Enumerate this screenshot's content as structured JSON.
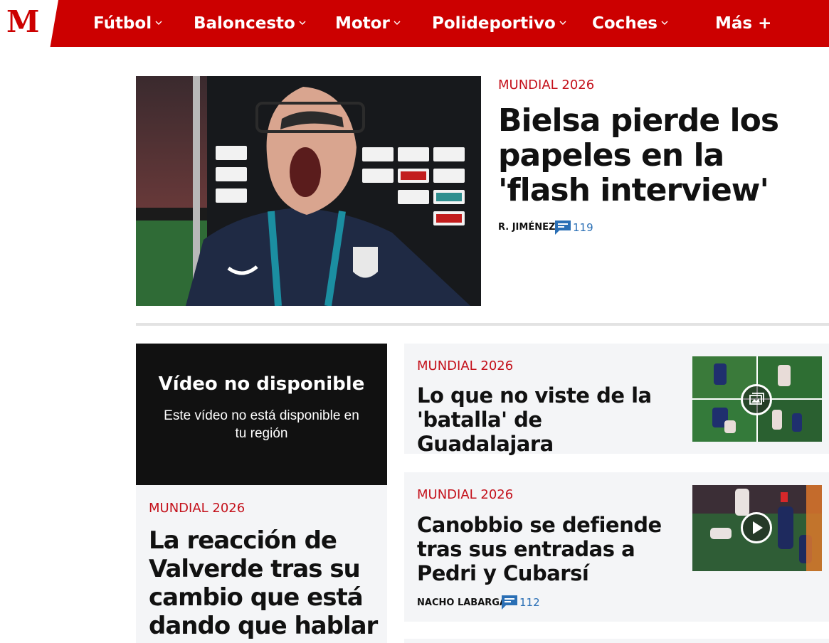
{
  "brand": {
    "logo_letter": "M"
  },
  "nav": [
    {
      "label": "Fútbol",
      "dropdown": true
    },
    {
      "label": "Baloncesto",
      "dropdown": true
    },
    {
      "label": "Motor",
      "dropdown": true
    },
    {
      "label": "Polideportivo",
      "dropdown": true
    },
    {
      "label": "Coches",
      "dropdown": true
    },
    {
      "label": "Más +",
      "dropdown": false
    }
  ],
  "hero": {
    "kicker": "MUNDIAL 2026",
    "title": "Bielsa pierde los papeles en la 'flash interview'",
    "author": "R. JIMÉNEZ",
    "comments": "119"
  },
  "video": {
    "title": "Vídeo no disponible",
    "message": "Este vídeo no está disponible en tu región",
    "kicker": "MUNDIAL 2026",
    "headline": "La reacción de Valverde tras su cambio que está dando que hablar"
  },
  "articles": [
    {
      "kicker": "MUNDIAL 2026",
      "title": "Lo que no viste de la 'batalla' de Guadalajara",
      "media": "gallery-icon"
    },
    {
      "kicker": "MUNDIAL 2026",
      "title": "Canobbio se defiende tras sus entradas a Pedri y Cubarsí",
      "author": "NACHO LABARGA",
      "comments": "112",
      "media": "play-icon"
    }
  ],
  "colors": {
    "brand_red": "#cc0000",
    "kicker_red": "#c4111b",
    "comment_blue": "#2a6fb5",
    "card_bg": "#f4f5f7"
  }
}
